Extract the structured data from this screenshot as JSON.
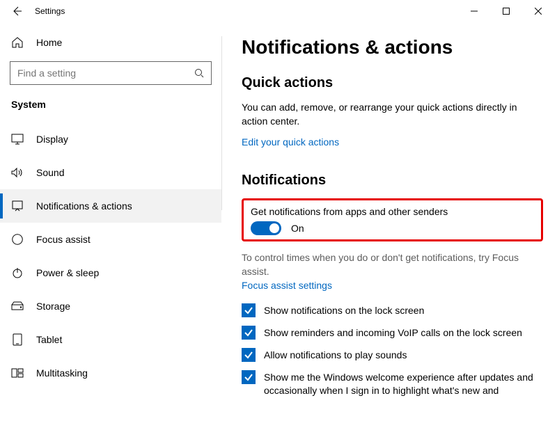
{
  "titlebar": {
    "title": "Settings"
  },
  "sidebar": {
    "home_label": "Home",
    "search_placeholder": "Find a setting",
    "category_label": "System",
    "items": [
      {
        "label": "Display"
      },
      {
        "label": "Sound"
      },
      {
        "label": "Notifications & actions"
      },
      {
        "label": "Focus assist"
      },
      {
        "label": "Power & sleep"
      },
      {
        "label": "Storage"
      },
      {
        "label": "Tablet"
      },
      {
        "label": "Multitasking"
      }
    ]
  },
  "main": {
    "page_title": "Notifications & actions",
    "quick_actions_heading": "Quick actions",
    "quick_actions_desc": "You can add, remove, or rearrange your quick actions directly in action center.",
    "edit_quick_actions_link": "Edit your quick actions",
    "notifications_heading": "Notifications",
    "get_notifications_label": "Get notifications from apps and other senders",
    "toggle_on_label": "On",
    "focus_caption": "To control times when you do or don't get notifications, try Focus assist.",
    "focus_assist_link": "Focus assist settings",
    "checks": [
      {
        "label": "Show notifications on the lock screen"
      },
      {
        "label": "Show reminders and incoming VoIP calls on the lock screen"
      },
      {
        "label": "Allow notifications to play sounds"
      },
      {
        "label": "Show me the Windows welcome experience after updates and occasionally when I sign in to highlight what's new and"
      }
    ]
  }
}
